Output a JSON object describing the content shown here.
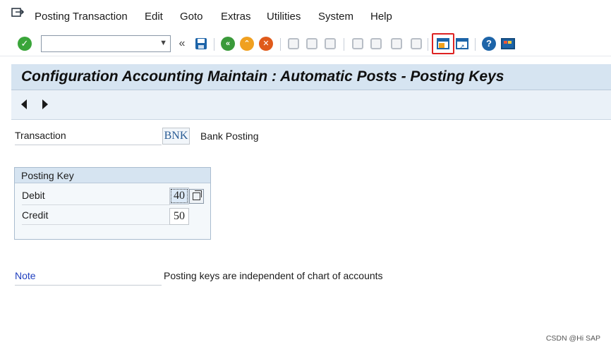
{
  "menu": {
    "items": [
      {
        "label": "Posting Transaction",
        "name": "menu-posting-transaction"
      },
      {
        "label": "Edit",
        "name": "menu-edit"
      },
      {
        "label": "Goto",
        "name": "menu-goto"
      },
      {
        "label": "Extras",
        "name": "menu-extras"
      },
      {
        "label": "Utilities",
        "name": "menu-utilities"
      },
      {
        "label": "System",
        "name": "menu-system"
      },
      {
        "label": "Help",
        "name": "menu-help"
      }
    ]
  },
  "toolbar": {
    "command_value": "",
    "back_label": "«",
    "dropdown_glyph": "▼",
    "icons": [
      "enter-icon",
      "save-icon",
      "back-icon",
      "exit-icon",
      "cancel-icon",
      "print-icon",
      "find-icon",
      "find-next-icon",
      "first-page-icon",
      "previous-page-icon",
      "next-page-icon",
      "last-page-icon",
      "create-session-icon",
      "shortcut-icon",
      "help-icon",
      "customize-layout-icon"
    ]
  },
  "title": "Configuration Accounting Maintain : Automatic Posts - Posting Keys",
  "transaction": {
    "label": "Transaction",
    "code": "BNK",
    "description": "Bank Posting"
  },
  "posting_key": {
    "group_title": "Posting Key",
    "debit_label": "Debit",
    "debit_value": "40",
    "credit_label": "Credit",
    "credit_value": "50"
  },
  "note": {
    "label": "Note",
    "text": "Posting keys are independent of chart of accounts"
  },
  "watermark": "CSDN @Hi SAP",
  "colors": {
    "title_bar": "#d6e4f1",
    "note_label": "#1f3fbf",
    "enter_green": "#3aa53a",
    "sap_blue": "#1d64a8"
  }
}
